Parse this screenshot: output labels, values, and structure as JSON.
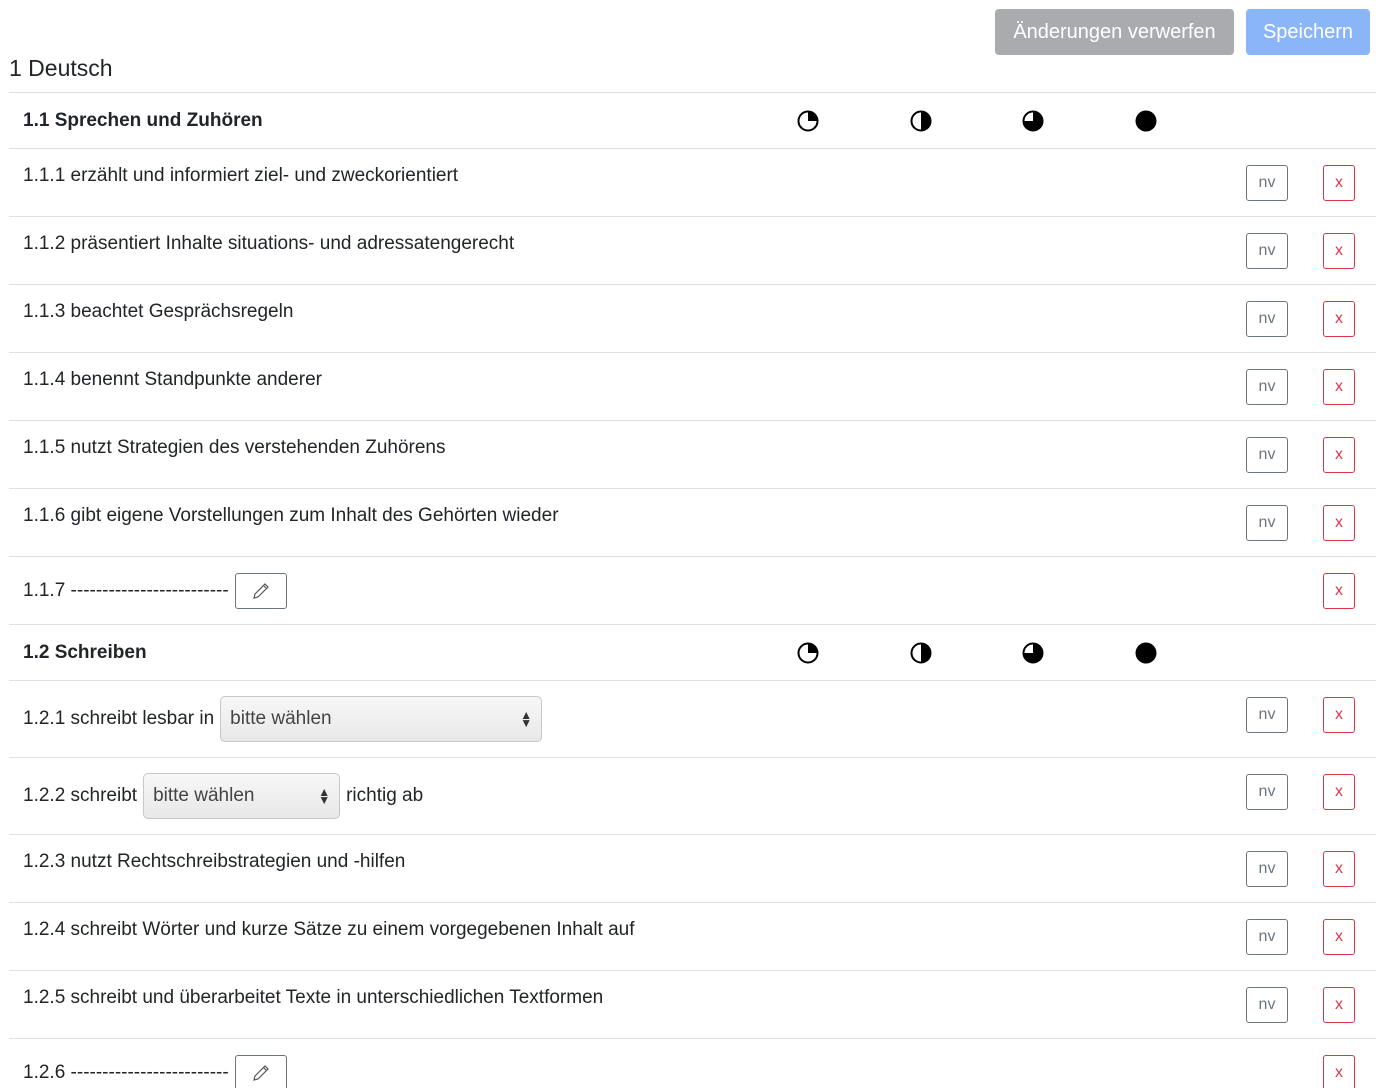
{
  "toolbar": {
    "discard_label": "Änderungen verwerfen",
    "save_label": "Speichern"
  },
  "subject": {
    "title": "1 Deutsch"
  },
  "columns": {
    "levels": [
      "quarter",
      "half",
      "three-quarter",
      "full"
    ]
  },
  "sections": [
    {
      "title": "1.1 Sprechen und Zuhören",
      "items": [
        {
          "text": "1.1.1 erzählt und informiert ziel- und zweckorientiert",
          "nv": "nv",
          "x": "x"
        },
        {
          "text": "1.1.2 präsentiert Inhalte situations- und adressatengerecht",
          "nv": "nv",
          "x": "x"
        },
        {
          "text": "1.1.3 beachtet Gesprächsregeln",
          "nv": "nv",
          "x": "x"
        },
        {
          "text": "1.1.4 benennt Standpunkte anderer",
          "nv": "nv",
          "x": "x"
        },
        {
          "text": "1.1.5 nutzt Strategien des verstehenden Zuhörens",
          "nv": "nv",
          "x": "x"
        },
        {
          "text": "1.1.6 gibt eigene Vorstellungen zum Inhalt des Gehörten wieder",
          "nv": "nv",
          "x": "x"
        },
        {
          "text": "1.1.7 -------------------------",
          "x": "x"
        }
      ]
    },
    {
      "title": "1.2 Schreiben",
      "items": [
        {
          "prefix": "1.2.1 schreibt lesbar in",
          "select": "bitte wählen",
          "nv": "nv",
          "x": "x"
        },
        {
          "prefix": "1.2.2 schreibt",
          "select": "bitte wählen",
          "suffix": "richtig ab",
          "nv": "nv",
          "x": "x"
        },
        {
          "text": "1.2.3 nutzt Rechtschreibstrategien und -hilfen",
          "nv": "nv",
          "x": "x"
        },
        {
          "text": "1.2.4 schreibt Wörter und kurze Sätze zu einem vorgegebenen Inhalt auf",
          "nv": "nv",
          "x": "x"
        },
        {
          "text": "1.2.5 schreibt und überarbeitet Texte in unterschiedlichen Textformen",
          "nv": "nv",
          "x": "x"
        },
        {
          "text": "1.2.6 -------------------------",
          "x": "x"
        }
      ]
    }
  ]
}
